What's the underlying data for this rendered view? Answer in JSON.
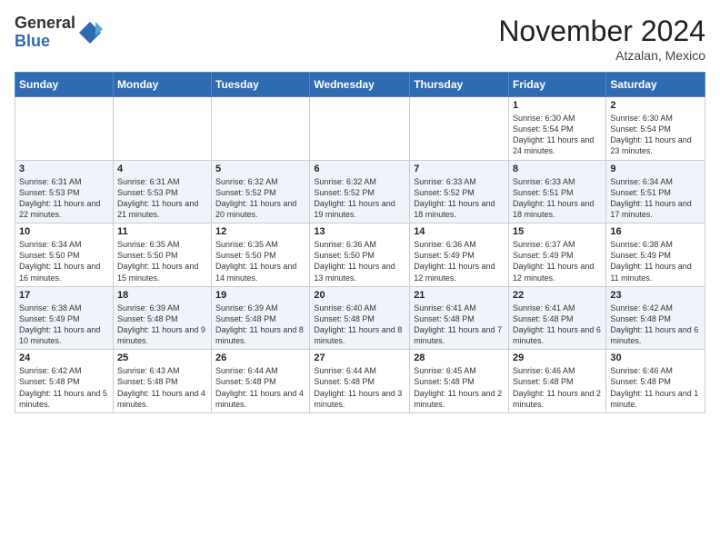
{
  "header": {
    "logo_general": "General",
    "logo_blue": "Blue",
    "month_title": "November 2024",
    "location": "Atzalan, Mexico"
  },
  "weekdays": [
    "Sunday",
    "Monday",
    "Tuesday",
    "Wednesday",
    "Thursday",
    "Friday",
    "Saturday"
  ],
  "weeks": [
    [
      {
        "day": "",
        "info": ""
      },
      {
        "day": "",
        "info": ""
      },
      {
        "day": "",
        "info": ""
      },
      {
        "day": "",
        "info": ""
      },
      {
        "day": "",
        "info": ""
      },
      {
        "day": "1",
        "info": "Sunrise: 6:30 AM\nSunset: 5:54 PM\nDaylight: 11 hours and 24 minutes."
      },
      {
        "day": "2",
        "info": "Sunrise: 6:30 AM\nSunset: 5:54 PM\nDaylight: 11 hours and 23 minutes."
      }
    ],
    [
      {
        "day": "3",
        "info": "Sunrise: 6:31 AM\nSunset: 5:53 PM\nDaylight: 11 hours and 22 minutes."
      },
      {
        "day": "4",
        "info": "Sunrise: 6:31 AM\nSunset: 5:53 PM\nDaylight: 11 hours and 21 minutes."
      },
      {
        "day": "5",
        "info": "Sunrise: 6:32 AM\nSunset: 5:52 PM\nDaylight: 11 hours and 20 minutes."
      },
      {
        "day": "6",
        "info": "Sunrise: 6:32 AM\nSunset: 5:52 PM\nDaylight: 11 hours and 19 minutes."
      },
      {
        "day": "7",
        "info": "Sunrise: 6:33 AM\nSunset: 5:52 PM\nDaylight: 11 hours and 18 minutes."
      },
      {
        "day": "8",
        "info": "Sunrise: 6:33 AM\nSunset: 5:51 PM\nDaylight: 11 hours and 18 minutes."
      },
      {
        "day": "9",
        "info": "Sunrise: 6:34 AM\nSunset: 5:51 PM\nDaylight: 11 hours and 17 minutes."
      }
    ],
    [
      {
        "day": "10",
        "info": "Sunrise: 6:34 AM\nSunset: 5:50 PM\nDaylight: 11 hours and 16 minutes."
      },
      {
        "day": "11",
        "info": "Sunrise: 6:35 AM\nSunset: 5:50 PM\nDaylight: 11 hours and 15 minutes."
      },
      {
        "day": "12",
        "info": "Sunrise: 6:35 AM\nSunset: 5:50 PM\nDaylight: 11 hours and 14 minutes."
      },
      {
        "day": "13",
        "info": "Sunrise: 6:36 AM\nSunset: 5:50 PM\nDaylight: 11 hours and 13 minutes."
      },
      {
        "day": "14",
        "info": "Sunrise: 6:36 AM\nSunset: 5:49 PM\nDaylight: 11 hours and 12 minutes."
      },
      {
        "day": "15",
        "info": "Sunrise: 6:37 AM\nSunset: 5:49 PM\nDaylight: 11 hours and 12 minutes."
      },
      {
        "day": "16",
        "info": "Sunrise: 6:38 AM\nSunset: 5:49 PM\nDaylight: 11 hours and 11 minutes."
      }
    ],
    [
      {
        "day": "17",
        "info": "Sunrise: 6:38 AM\nSunset: 5:49 PM\nDaylight: 11 hours and 10 minutes."
      },
      {
        "day": "18",
        "info": "Sunrise: 6:39 AM\nSunset: 5:48 PM\nDaylight: 11 hours and 9 minutes."
      },
      {
        "day": "19",
        "info": "Sunrise: 6:39 AM\nSunset: 5:48 PM\nDaylight: 11 hours and 8 minutes."
      },
      {
        "day": "20",
        "info": "Sunrise: 6:40 AM\nSunset: 5:48 PM\nDaylight: 11 hours and 8 minutes."
      },
      {
        "day": "21",
        "info": "Sunrise: 6:41 AM\nSunset: 5:48 PM\nDaylight: 11 hours and 7 minutes."
      },
      {
        "day": "22",
        "info": "Sunrise: 6:41 AM\nSunset: 5:48 PM\nDaylight: 11 hours and 6 minutes."
      },
      {
        "day": "23",
        "info": "Sunrise: 6:42 AM\nSunset: 5:48 PM\nDaylight: 11 hours and 6 minutes."
      }
    ],
    [
      {
        "day": "24",
        "info": "Sunrise: 6:42 AM\nSunset: 5:48 PM\nDaylight: 11 hours and 5 minutes."
      },
      {
        "day": "25",
        "info": "Sunrise: 6:43 AM\nSunset: 5:48 PM\nDaylight: 11 hours and 4 minutes."
      },
      {
        "day": "26",
        "info": "Sunrise: 6:44 AM\nSunset: 5:48 PM\nDaylight: 11 hours and 4 minutes."
      },
      {
        "day": "27",
        "info": "Sunrise: 6:44 AM\nSunset: 5:48 PM\nDaylight: 11 hours and 3 minutes."
      },
      {
        "day": "28",
        "info": "Sunrise: 6:45 AM\nSunset: 5:48 PM\nDaylight: 11 hours and 2 minutes."
      },
      {
        "day": "29",
        "info": "Sunrise: 6:46 AM\nSunset: 5:48 PM\nDaylight: 11 hours and 2 minutes."
      },
      {
        "day": "30",
        "info": "Sunrise: 6:46 AM\nSunset: 5:48 PM\nDaylight: 11 hours and 1 minute."
      }
    ]
  ]
}
